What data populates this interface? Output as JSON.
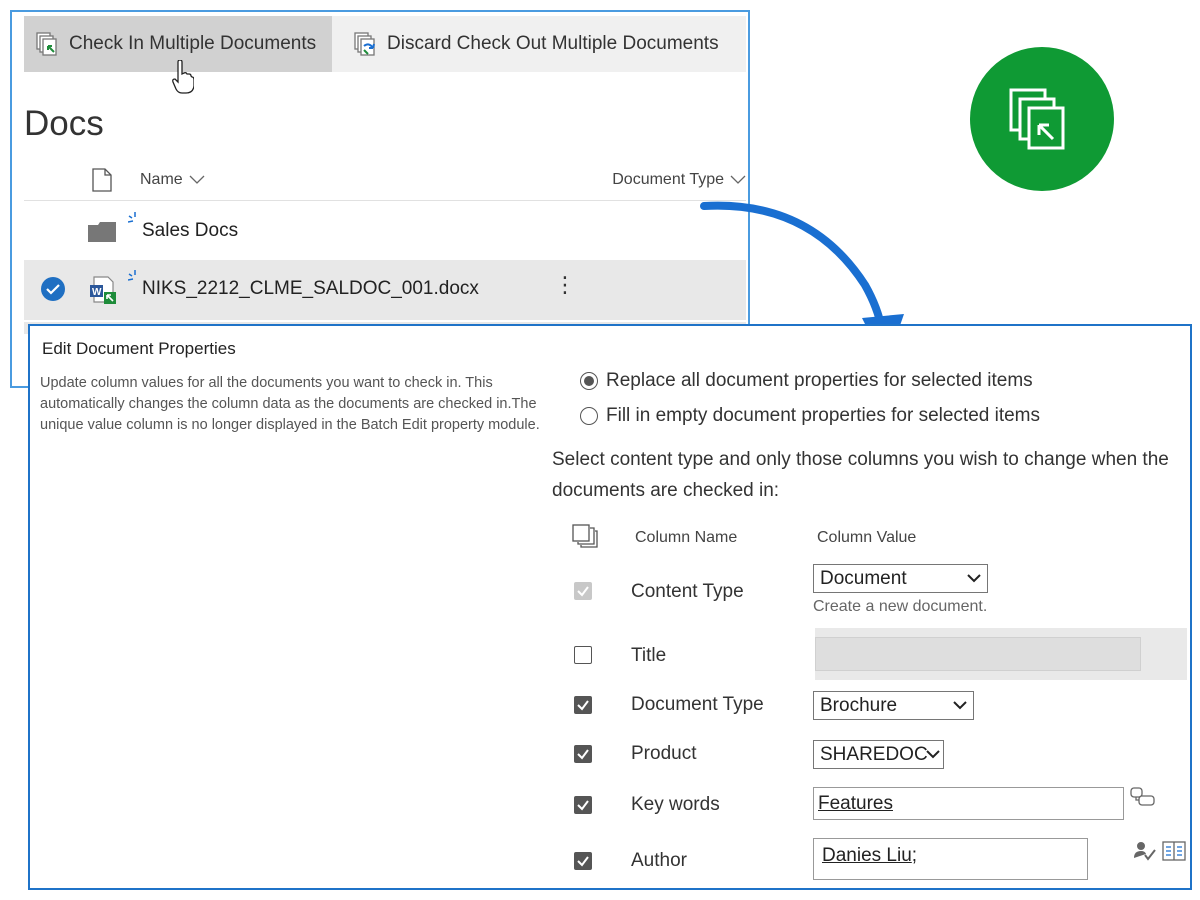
{
  "toolbar": {
    "check_in_label": "Check In Multiple Documents",
    "discard_label": "Discard Check Out Multiple Documents"
  },
  "library": {
    "title": "Docs",
    "columns": {
      "name": "Name",
      "document_type": "Document Type"
    },
    "rows": [
      {
        "name": "Sales Docs",
        "kind": "folder",
        "selected": false
      },
      {
        "name": "NIKS_2212_CLME_SALDOC_001.docx",
        "kind": "docx",
        "selected": true
      }
    ],
    "more_glyph": "⋮"
  },
  "edit_panel": {
    "title": "Edit Document Properties",
    "description": "Update column values for all the documents you want to check in. This automatically changes the column data as the documents are checked in.The unique value column is no longer displayed in the Batch Edit property module.",
    "radio_options": [
      {
        "label": "Replace all document properties for selected items",
        "checked": true
      },
      {
        "label": "Fill in empty document properties for selected items",
        "checked": false
      }
    ],
    "instructions": "Select content type and only those columns you wish to change when the documents are checked in:",
    "grid_headers": {
      "column_name": "Column Name",
      "column_value": "Column Value"
    },
    "properties": {
      "content_type": {
        "label": "Content Type",
        "value": "Document",
        "help": "Create a new document.",
        "checked": true,
        "disabled": true
      },
      "title": {
        "label": "Title",
        "value": "",
        "checked": false
      },
      "document_type": {
        "label": "Document Type",
        "value": "Brochure",
        "checked": true
      },
      "product": {
        "label": "Product",
        "value": "SHAREDOC",
        "checked": true
      },
      "key_words": {
        "label": "Key words",
        "value": "Features",
        "checked": true
      },
      "author": {
        "label": "Author",
        "value": "Danies Liu",
        "suffix": ";",
        "checked": true
      }
    }
  },
  "colors": {
    "panel_border_light": "#4a9be0",
    "panel_border_dark": "#1f73c8",
    "badge_green": "#0f9a34",
    "arrow_blue": "#1a6fd1",
    "selected_check": "#1f6fc2"
  },
  "icons": {
    "check_in": "check-in-docs-icon",
    "discard": "discard-checkout-docs-icon",
    "badge": "check-in-multiple-icon",
    "terms": "manage-terms-icon",
    "people": "check-names-icon",
    "address_book": "address-book-icon"
  }
}
